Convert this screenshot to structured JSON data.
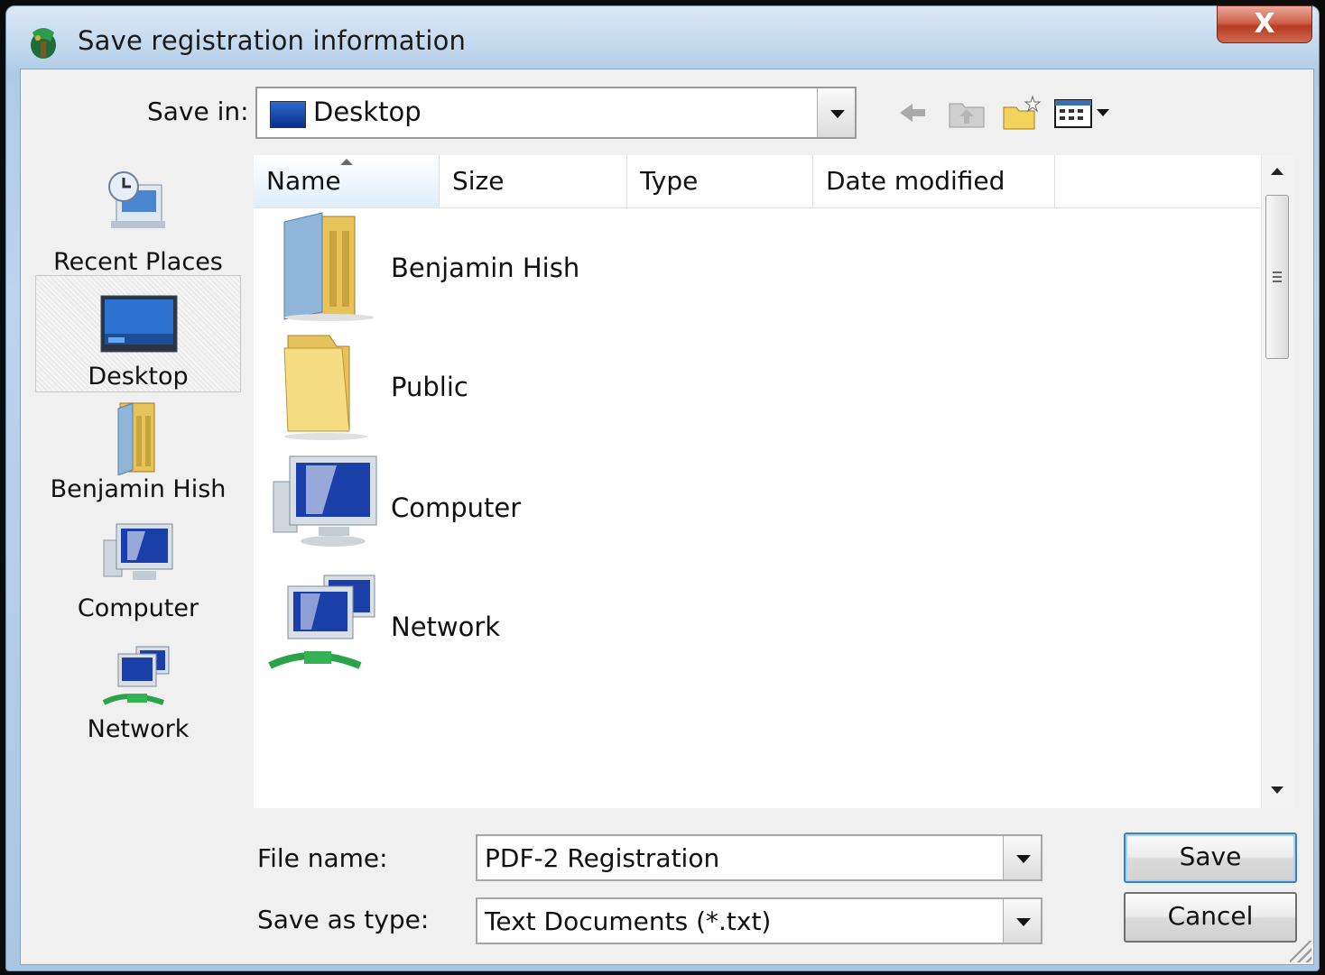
{
  "window": {
    "title": "Save registration information",
    "close_label": "X"
  },
  "toolbar": {
    "save_in_label": "Save in:",
    "save_in_value": "Desktop",
    "buttons": [
      "back-icon",
      "up-folder-icon",
      "new-folder-icon",
      "views-menu-icon"
    ]
  },
  "places": [
    {
      "label": "Recent Places",
      "icon": "recent-places-icon"
    },
    {
      "label": "Desktop",
      "icon": "desktop-icon",
      "selected": true
    },
    {
      "label": "Benjamin Hish",
      "icon": "user-folder-icon"
    },
    {
      "label": "Computer",
      "icon": "computer-icon"
    },
    {
      "label": "Network",
      "icon": "network-icon"
    }
  ],
  "file_list": {
    "columns": [
      "Name",
      "Size",
      "Type",
      "Date modified"
    ],
    "sorted_column": "Name",
    "items": [
      {
        "name": "Benjamin Hish",
        "icon": "user-folder-icon"
      },
      {
        "name": "Public",
        "icon": "folder-icon"
      },
      {
        "name": "Computer",
        "icon": "computer-icon"
      },
      {
        "name": "Network",
        "icon": "network-icon"
      }
    ]
  },
  "form": {
    "file_name_label": "File name:",
    "file_name_value": "PDF-2 Registration",
    "save_as_type_label": "Save as type:",
    "save_as_type_value": "Text Documents (*.txt)"
  },
  "buttons": {
    "save": "Save",
    "cancel": "Cancel"
  }
}
